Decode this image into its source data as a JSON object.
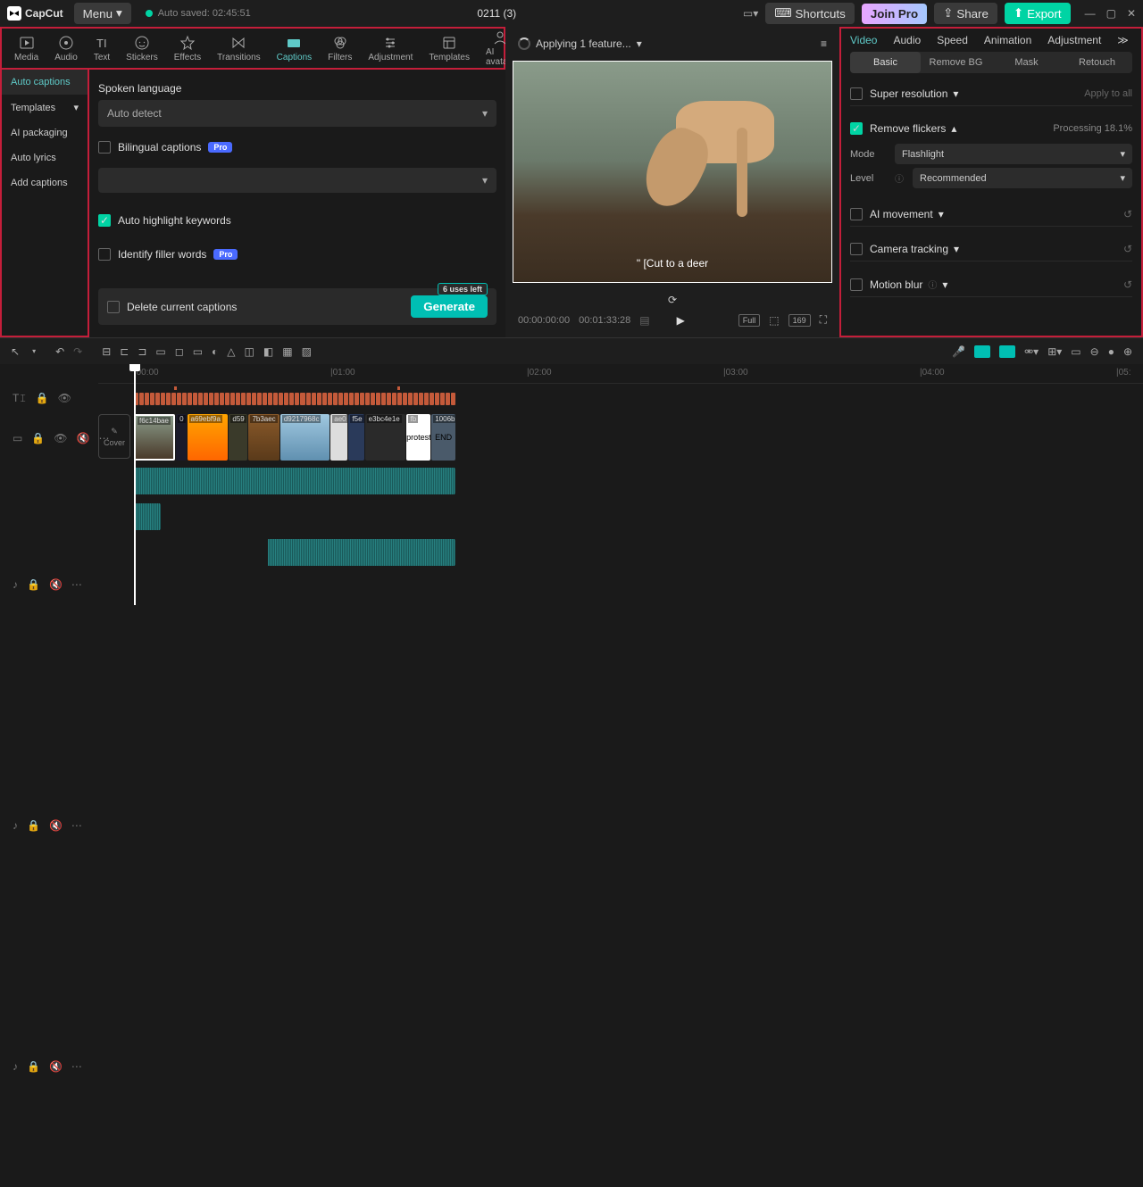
{
  "app": {
    "name": "CapCut",
    "menu": "Menu",
    "autosave": "Auto saved: 02:45:51",
    "project": "0211 (3)"
  },
  "titlebar": {
    "shortcuts": "Shortcuts",
    "join_pro": "Join Pro",
    "share": "Share",
    "export": "Export"
  },
  "toolbar_tabs": [
    "Media",
    "Audio",
    "Text",
    "Stickers",
    "Effects",
    "Transitions",
    "Captions",
    "Filters",
    "Adjustment",
    "Templates",
    "AI avatars"
  ],
  "sidebar": [
    "Auto captions",
    "Templates",
    "AI packaging",
    "Auto lyrics",
    "Add captions"
  ],
  "captions": {
    "spoken_language_label": "Spoken language",
    "spoken_language_value": "Auto detect",
    "bilingual": "Bilingual captions",
    "highlight": "Auto highlight keywords",
    "filler": "Identify filler words",
    "delete": "Delete current captions",
    "generate": "Generate",
    "uses_left": "6 uses left",
    "pro": "Pro"
  },
  "preview": {
    "status": "Applying 1 feature...",
    "caption": "\" [Cut to a deer",
    "time_current": "00:00:00:00",
    "time_total": "00:01:33:28"
  },
  "right": {
    "tabs": [
      "Video",
      "Audio",
      "Speed",
      "Animation",
      "Adjustment"
    ],
    "subtabs": [
      "Basic",
      "Remove BG",
      "Mask",
      "Retouch"
    ],
    "super_resolution": "Super resolution",
    "apply_all": "Apply to all",
    "remove_flickers": "Remove flickers",
    "processing": "Processing 18.1%",
    "mode_label": "Mode",
    "mode_value": "Flashlight",
    "level_label": "Level",
    "level_value": "Recommended",
    "ai_movement": "AI movement",
    "camera_tracking": "Camera tracking",
    "motion_blur": "Motion blur"
  },
  "ruler": [
    "|00:00",
    "|01:00",
    "|02:00",
    "|03:00",
    "|04:00",
    "|05:"
  ],
  "clips": [
    "f6c14bae",
    "0",
    "a69ebf9a",
    "d59",
    "7b3aec",
    "d9217968c",
    "ae0",
    "f5e",
    "e3bc4e1e",
    "fb",
    "1006b"
  ],
  "cover": "Cover",
  "full": "Full",
  "resolution": "169"
}
